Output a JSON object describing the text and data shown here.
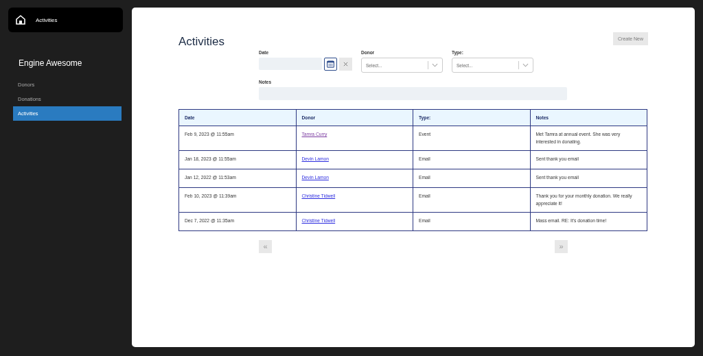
{
  "header": {
    "title": "Activities"
  },
  "sidebar": {
    "brand": "Engine Awesome",
    "items": [
      {
        "label": "Donors",
        "selected": false
      },
      {
        "label": "Donations",
        "selected": false
      },
      {
        "label": "Activities",
        "selected": true
      }
    ]
  },
  "page": {
    "title": "Activities",
    "create_button": "Create New"
  },
  "filters": {
    "date": {
      "label": "Date"
    },
    "donor": {
      "label": "Donor",
      "placeholder": "Select..."
    },
    "type": {
      "label": "Type:",
      "placeholder": "Select..."
    },
    "notes": {
      "label": "Notes"
    }
  },
  "table": {
    "columns": [
      "Date",
      "Donor",
      "Type:",
      "Notes"
    ],
    "rows": [
      {
        "date": "Feb 9, 2023 @ 11:55am",
        "donor": "Tamra Curry",
        "visited": true,
        "type": "Event",
        "notes": "Met Tamra at annual event. She was very interested in donating."
      },
      {
        "date": "Jan 18, 2023 @ 11:55am",
        "donor": "Devin Lamon",
        "visited": false,
        "type": "Email",
        "notes": "Sent thank you email"
      },
      {
        "date": "Jan 12, 2022 @ 11:53am",
        "donor": "Devin Lamon",
        "visited": false,
        "type": "Email",
        "notes": "Sent thank you email"
      },
      {
        "date": "Feb 10, 2023 @ 11:39am",
        "donor": "Christine Tidwell",
        "visited": false,
        "type": "Email",
        "notes": "Thank you for your monthly donation. We really appreciate it!"
      },
      {
        "date": "Dec 7, 2022 @ 11:35am",
        "donor": "Christine Tidwell",
        "visited": false,
        "type": "Email",
        "notes": "Mass email. RE: It's donation time!"
      }
    ]
  },
  "pagination": {
    "previous": "«",
    "next": "»"
  }
}
